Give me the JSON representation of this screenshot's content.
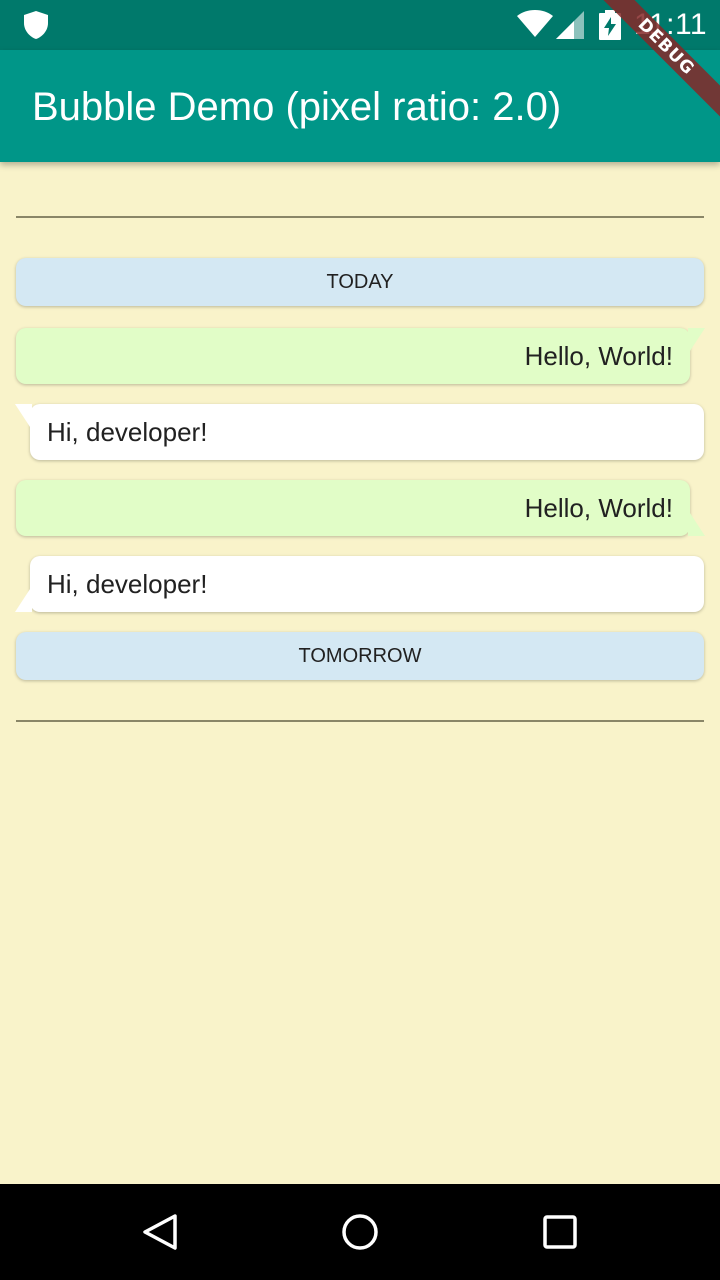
{
  "status_bar": {
    "time": "11:11",
    "icons": [
      "shield-icon",
      "wifi-icon",
      "cell-signal-icon",
      "battery-charging-icon"
    ]
  },
  "debug_banner": "DEBUG",
  "app_bar": {
    "title": "Bubble Demo (pixel ratio: 2.0)",
    "color": "#009688"
  },
  "chat": {
    "background": "#f9f3ca",
    "date_today": "TODAY",
    "date_tomorrow": "TOMORROW",
    "messages": [
      {
        "side": "sent",
        "text": "Hello, World!",
        "tail": "top"
      },
      {
        "side": "received",
        "text": "Hi, developer!",
        "tail": "top"
      },
      {
        "side": "sent",
        "text": "Hello, World!",
        "tail": "bottom"
      },
      {
        "side": "received",
        "text": "Hi, developer!",
        "tail": "bottom"
      }
    ],
    "sent_color": "#e1fdc7",
    "received_color": "#ffffff",
    "date_color": "#d4e8f3"
  },
  "nav_bar": {
    "buttons": [
      "back-icon",
      "home-icon",
      "recents-icon"
    ]
  }
}
